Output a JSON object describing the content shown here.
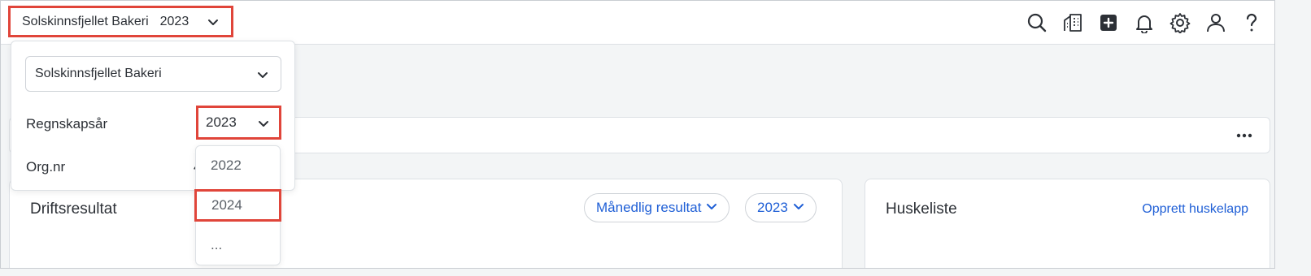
{
  "topbar": {
    "company_name": "Solskinnsfjellet Bakeri",
    "year": "2023",
    "icons": [
      "search-icon",
      "company-building-icon",
      "add-icon",
      "bell-icon",
      "gear-icon",
      "user-icon",
      "help-icon"
    ]
  },
  "popover": {
    "company_select_value": "Solskinnsfjellet Bakeri",
    "fiscal_year_label": "Regnskapsår",
    "fiscal_year_value": "2023",
    "org_label": "Org.nr",
    "org_value_partial": "4"
  },
  "year_menu": {
    "options": [
      "2022",
      "2024",
      "..."
    ]
  },
  "dashboard": {
    "operating_result_title": "Driftsresultat",
    "monthly_result_label": "Månedlig resultat",
    "operating_year": "2023",
    "todo_title": "Huskeliste",
    "create_todo_label": "Opprett huskelapp"
  },
  "colors": {
    "highlight": "#e0453a",
    "link": "#1f5fd6",
    "background": "#f3f5f6"
  }
}
